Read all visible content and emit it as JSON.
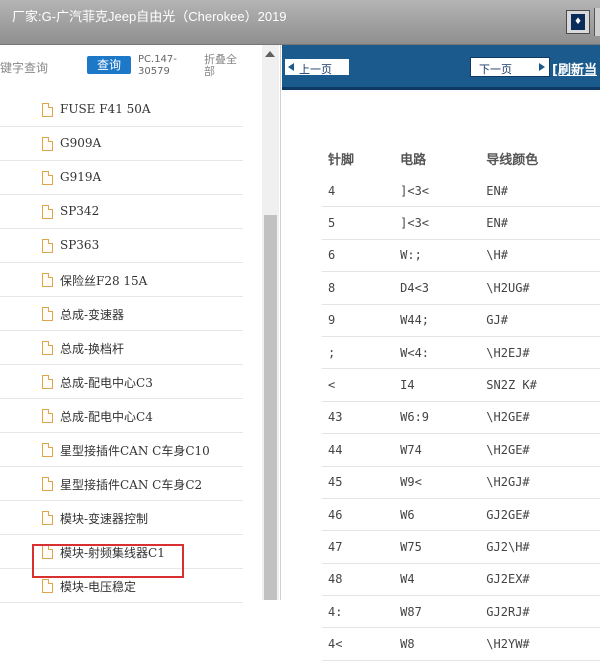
{
  "window": {
    "title": "厂家:G-广汽菲克Jeep自由光（Cherokee）2019"
  },
  "left_panel": {
    "search_label": "键字查询",
    "search_button": "查询",
    "part_code": "PC.147-30579",
    "collapse_all": "折叠全部",
    "tree_items": [
      "FUSE F41 50A",
      "G909A",
      "G919A",
      "SP342",
      "SP363",
      "保险丝F28 15A",
      "总成-变速器",
      "总成-换档杆",
      "总成-配电中心C3",
      "总成-配电中心C4",
      "星型接插件CAN C车身C10",
      "星型接插件CAN C车身C2",
      "模块-变速器控制",
      "模块-射频集线器C1",
      "模块-电压稳定"
    ],
    "selected_item": "模块-变速器控制"
  },
  "right_panel": {
    "prev_button": "上一页",
    "next_button": "下一页",
    "refresh_link": "[刷新当",
    "table": {
      "headers": [
        "针脚",
        "电路",
        "导线颜色"
      ],
      "rows": [
        [
          "4",
          "]<3<",
          "EN#"
        ],
        [
          "5",
          "]<3<",
          "EN#"
        ],
        [
          "6",
          "W:;",
          "\\H#"
        ],
        [
          "8",
          "D4<3",
          "\\H2UG#"
        ],
        [
          "9",
          "W44;",
          "GJ#"
        ],
        [
          ";",
          "W<4:",
          "\\H2EJ#"
        ],
        [
          "<",
          "I4",
          "SN2Z K#"
        ],
        [
          "43",
          "W6:9",
          "\\H2GE#"
        ],
        [
          "44",
          "W74",
          "\\H2GE#"
        ],
        [
          "45",
          "W9<",
          "\\H2GJ#"
        ],
        [
          "46",
          "W6",
          "GJ2GE#"
        ],
        [
          "47",
          "W75",
          "GJ2\\H#"
        ],
        [
          "48",
          "W4",
          "GJ2EX#"
        ],
        [
          "4:",
          "W87",
          "GJ2RJ#"
        ],
        [
          "4<",
          "W8",
          "\\H2YW#"
        ]
      ]
    }
  },
  "colors": {
    "nav_bar": "#1a5a8c",
    "search_button": "#1e78c8",
    "highlight_border": "#d83030",
    "file_icon": "#e0a44c"
  }
}
